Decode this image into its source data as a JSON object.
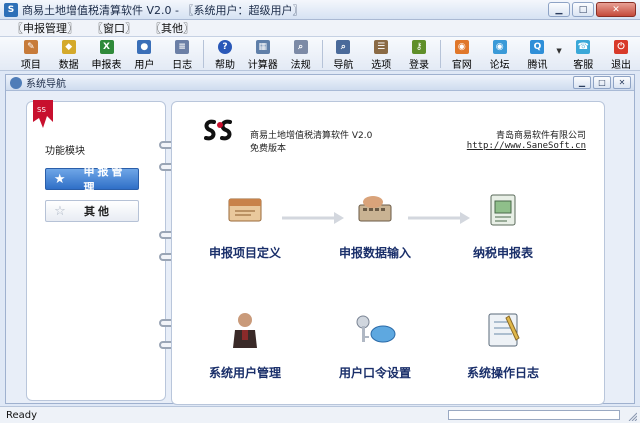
{
  "window": {
    "title": "商易土地增值税清算软件 V2.0 - 〖系统用户：超级用户〗",
    "controls": [
      "minimize",
      "maximize",
      "close"
    ]
  },
  "menu": [
    "〖申报管理〗",
    "〖窗口〗",
    "〖其他〗"
  ],
  "toolbar": [
    {
      "label": "项目",
      "icon": "project-icon",
      "color": "#c77b3a"
    },
    {
      "label": "数据",
      "icon": "data-icon",
      "color": "#d4a92a"
    },
    {
      "label": "申报表",
      "icon": "excel-icon",
      "color": "#2f8a3a"
    },
    {
      "label": "用户",
      "icon": "user-icon",
      "color": "#3a6fb8"
    },
    {
      "label": "日志",
      "icon": "log-icon",
      "color": "#6b7fa6"
    },
    {
      "label": "帮助",
      "icon": "help-icon",
      "color": "#2a58b8"
    },
    {
      "label": "计算器",
      "icon": "calculator-icon",
      "color": "#5f7fa9"
    },
    {
      "label": "法规",
      "icon": "search-icon",
      "color": "#7c8aa6"
    },
    {
      "label": "导航",
      "icon": "navigation-icon",
      "color": "#4a6a9a"
    },
    {
      "label": "选项",
      "icon": "options-icon",
      "color": "#8a6a45"
    },
    {
      "label": "登录",
      "icon": "login-icon",
      "color": "#5f8f2a"
    },
    {
      "label": "官网",
      "icon": "rss-icon",
      "color": "#e0772a"
    },
    {
      "label": "论坛",
      "icon": "forum-icon",
      "color": "#3a9ad8"
    },
    {
      "label": "腾讯",
      "icon": "qq-icon",
      "color": "#2f8fd8"
    },
    {
      "label": "客服",
      "icon": "service-icon",
      "color": "#3aa8d8"
    },
    {
      "label": "退出",
      "icon": "power-icon",
      "color": "#d83a2a"
    }
  ],
  "inner_window": {
    "title": "系统导航"
  },
  "left_panel": {
    "heading": "功能模块",
    "buttons": [
      {
        "label": "申报管理",
        "active": true
      },
      {
        "label": "其他",
        "active": false
      }
    ]
  },
  "right_panel": {
    "product_name": "商易土地增值税清算软件 V2.0",
    "edition": "免费版本",
    "company": "青岛商易软件有限公司",
    "url": "http://www.SaneSoft.cn",
    "features": [
      {
        "label": "申报项目定义",
        "icon": "project-definition-icon"
      },
      {
        "label": "申报数据输入",
        "icon": "keyboard-input-icon"
      },
      {
        "label": "纳税申报表",
        "icon": "tax-form-icon"
      },
      {
        "label": "系统用户管理",
        "icon": "user-management-icon"
      },
      {
        "label": "用户口令设置",
        "icon": "key-icon"
      },
      {
        "label": "系统操作日志",
        "icon": "notebook-icon"
      }
    ]
  },
  "status": {
    "text": "Ready"
  },
  "colors": {
    "accent": "#2f6fc7",
    "feature_text": "#1a2f6a",
    "logo_red": "#c8102e"
  }
}
